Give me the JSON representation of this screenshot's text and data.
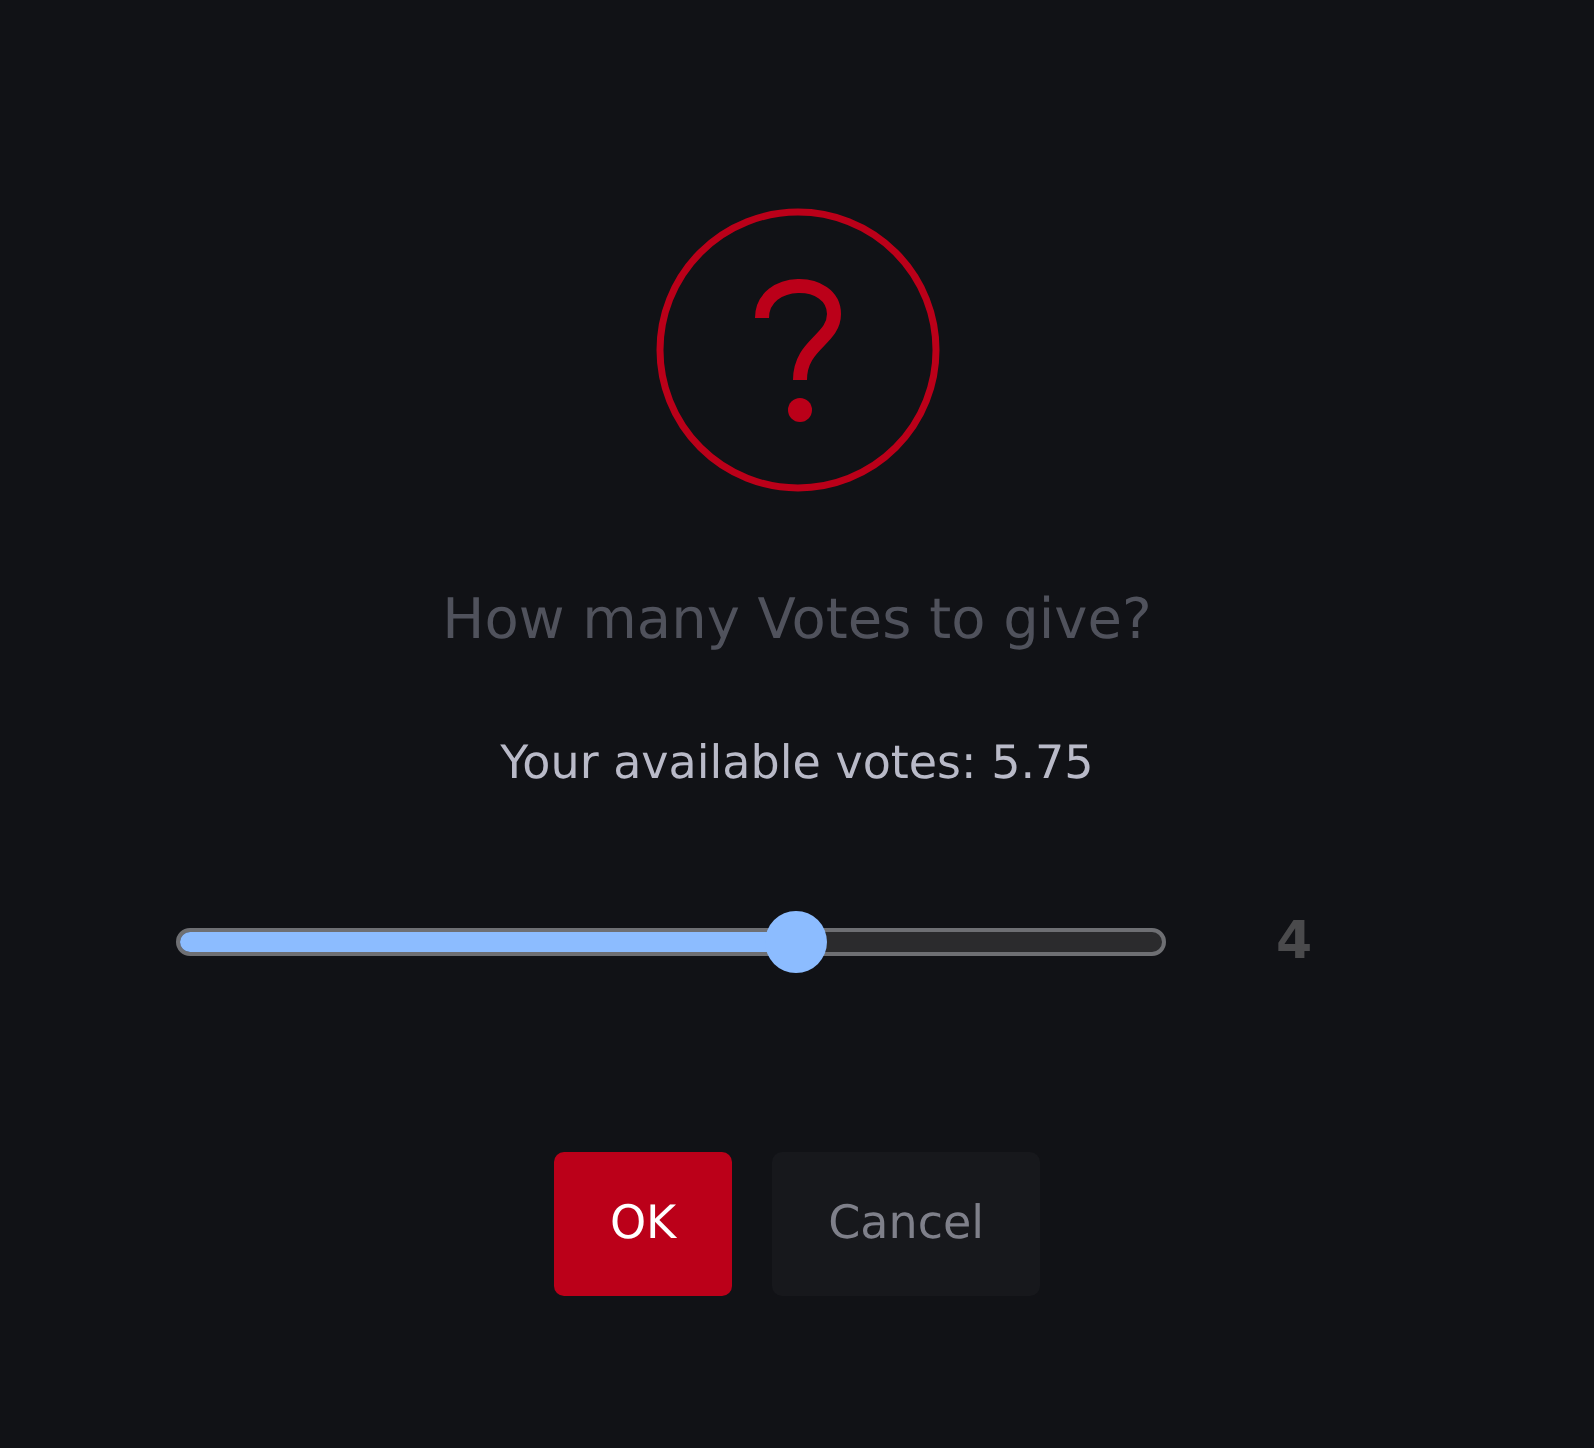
{
  "dialog": {
    "icon": {
      "kind": "question"
    },
    "title": "How many Votes to give?",
    "message": "Your available votes: 5.75",
    "slider": {
      "level": 0.626,
      "reading": "4"
    },
    "buttons": [
      {
        "label": "OK",
        "kind": "primary"
      },
      {
        "label": "Cancel",
        "kind": "secondary"
      }
    ]
  }
}
